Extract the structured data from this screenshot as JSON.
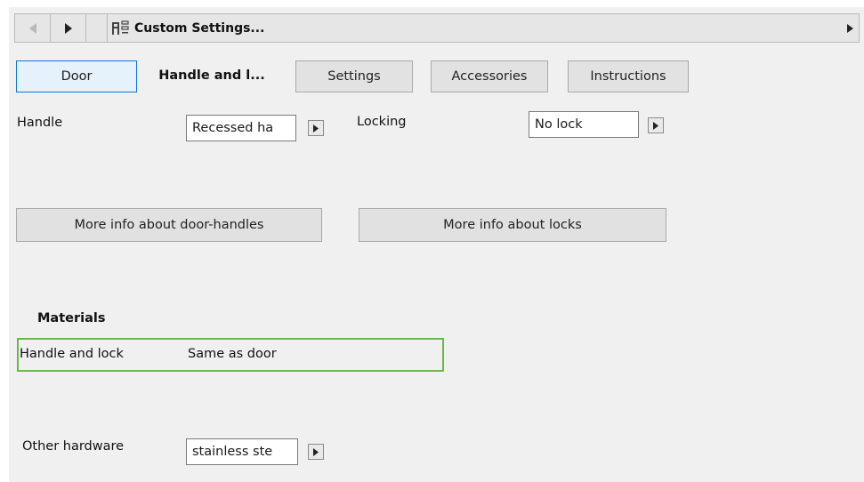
{
  "header": {
    "back_label": "◀",
    "forward_label": "▶",
    "title": "Custom Settings...",
    "menu_arrow": "▶"
  },
  "tabs": [
    {
      "label": "Door"
    },
    {
      "label": "Handle and l..."
    },
    {
      "label": "Settings"
    },
    {
      "label": "Accessories"
    },
    {
      "label": "Instructions"
    }
  ],
  "handle": {
    "label": "Handle",
    "value": "Recessed ha"
  },
  "locking": {
    "label": "Locking",
    "value": "No lock"
  },
  "buttons": {
    "door_handles_info": "More info about door-handles",
    "locks_info": "More info about locks"
  },
  "materials": {
    "heading": "Materials",
    "row_label": "Handle and lock",
    "row_value": "Same as door"
  },
  "other_hardware": {
    "label": "Other hardware",
    "value": "stainless ste"
  },
  "colors": {
    "active_tab_border": "#0a78d7",
    "material_border": "#6bb84a"
  }
}
